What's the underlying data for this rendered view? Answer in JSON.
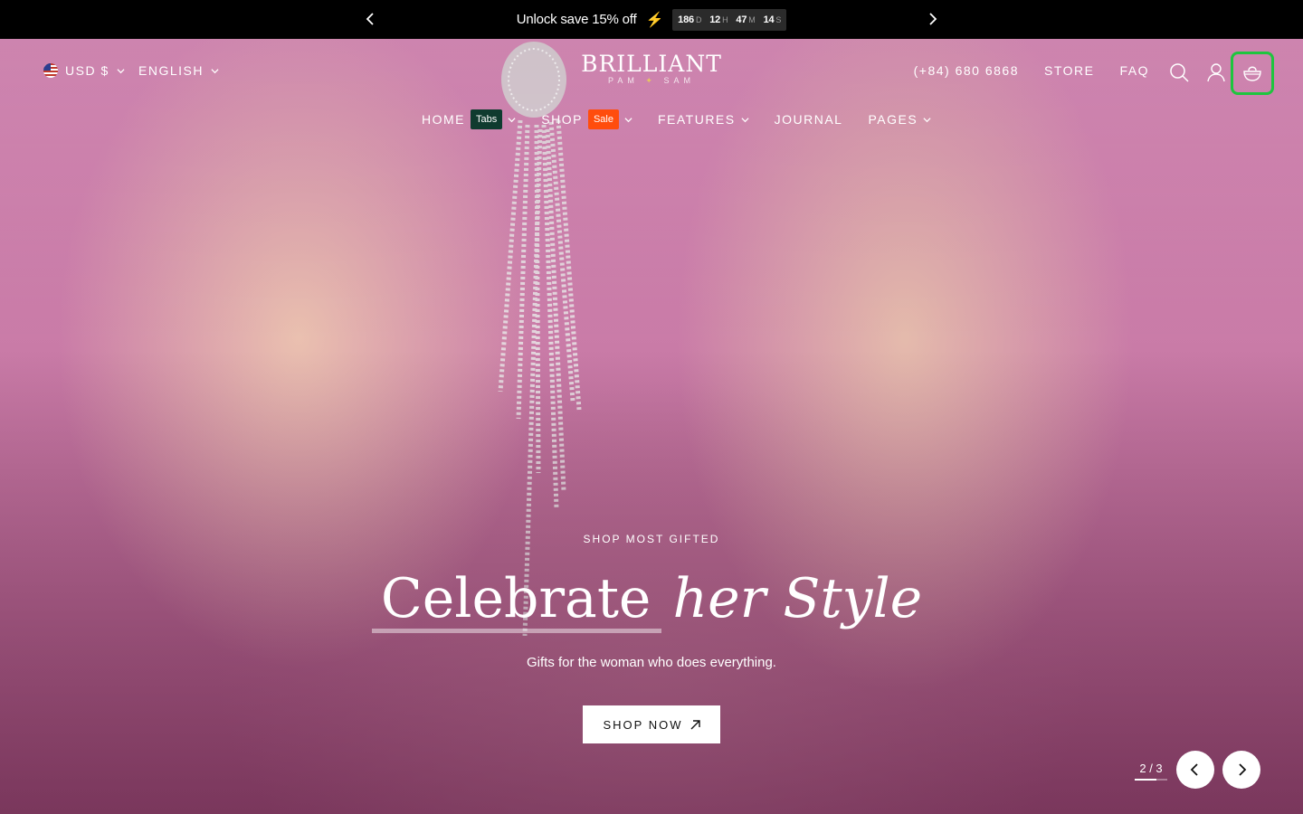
{
  "announcement": {
    "message": "Unlock save 15% off",
    "bolt": "⚡",
    "countdown": [
      {
        "value": "186",
        "unit": "D"
      },
      {
        "value": "12",
        "unit": "H"
      },
      {
        "value": "47",
        "unit": "M"
      },
      {
        "value": "14",
        "unit": "S"
      }
    ]
  },
  "header": {
    "currency": "USD $",
    "language": "ENGLISH",
    "logo": {
      "name": "BRILLIANT",
      "sub_left": "PAM",
      "sub_right": "SAM"
    },
    "phone": "(+84) 680 6868",
    "store": "STORE",
    "faq": "FAQ"
  },
  "nav": {
    "items": [
      {
        "label": "HOME",
        "badge": "Tabs"
      },
      {
        "label": "SHOP",
        "badge": "Sale"
      },
      {
        "label": "FEATURES"
      },
      {
        "label": "JOURNAL"
      },
      {
        "label": "PAGES"
      }
    ]
  },
  "hero": {
    "eyebrow": "SHOP MOST GIFTED",
    "headline_1": "Celebrate",
    "headline_2": "her Style",
    "subtitle": "Gifts for the woman who does everything.",
    "cta": "SHOP NOW",
    "slide_current": "2",
    "slide_total": "3",
    "slide_progress": 0.67
  },
  "colors": {
    "tabs_badge": "#0f3b2f",
    "sale_badge": "#ff4d0d",
    "cart_highlight": "#1ec53e"
  }
}
